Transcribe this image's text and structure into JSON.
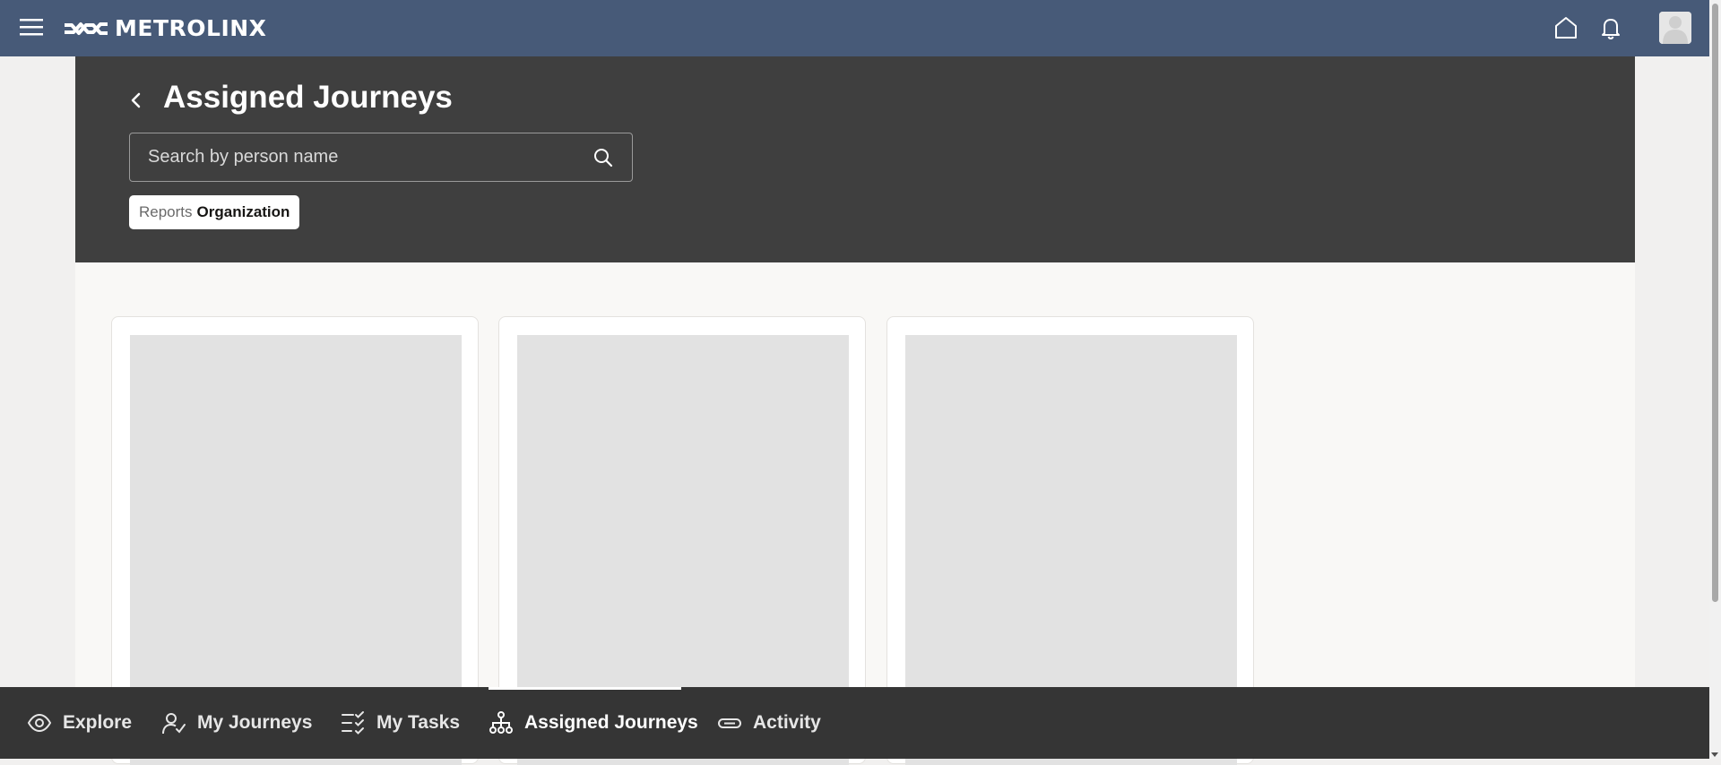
{
  "brand": {
    "name": "METROLINX"
  },
  "header": {
    "icons": [
      "hamburger-menu-icon",
      "home-icon",
      "bell-icon"
    ]
  },
  "page": {
    "title": "Assigned Journeys",
    "search": {
      "placeholder": "Search by person name",
      "value": ""
    },
    "filter_chip": {
      "prefix": "Reports",
      "value": "Organization"
    }
  },
  "cards": [
    {
      "state": "loading-placeholder"
    },
    {
      "state": "loading-placeholder"
    },
    {
      "state": "loading-placeholder"
    }
  ],
  "bottom_nav": {
    "items": [
      {
        "label": "Explore",
        "icon": "eye-icon"
      },
      {
        "label": "My Journeys",
        "icon": "person-check-icon"
      },
      {
        "label": "My Tasks",
        "icon": "checklist-icon"
      },
      {
        "label": "Assigned Journeys",
        "icon": "org-tree-icon",
        "active": true
      },
      {
        "label": "Activity",
        "icon": "pill-icon"
      }
    ]
  },
  "colors": {
    "topbar": "#475a78",
    "header_band": "#3f3f3f",
    "bottom_nav": "#353535",
    "placeholder": "#e2e2e2"
  }
}
